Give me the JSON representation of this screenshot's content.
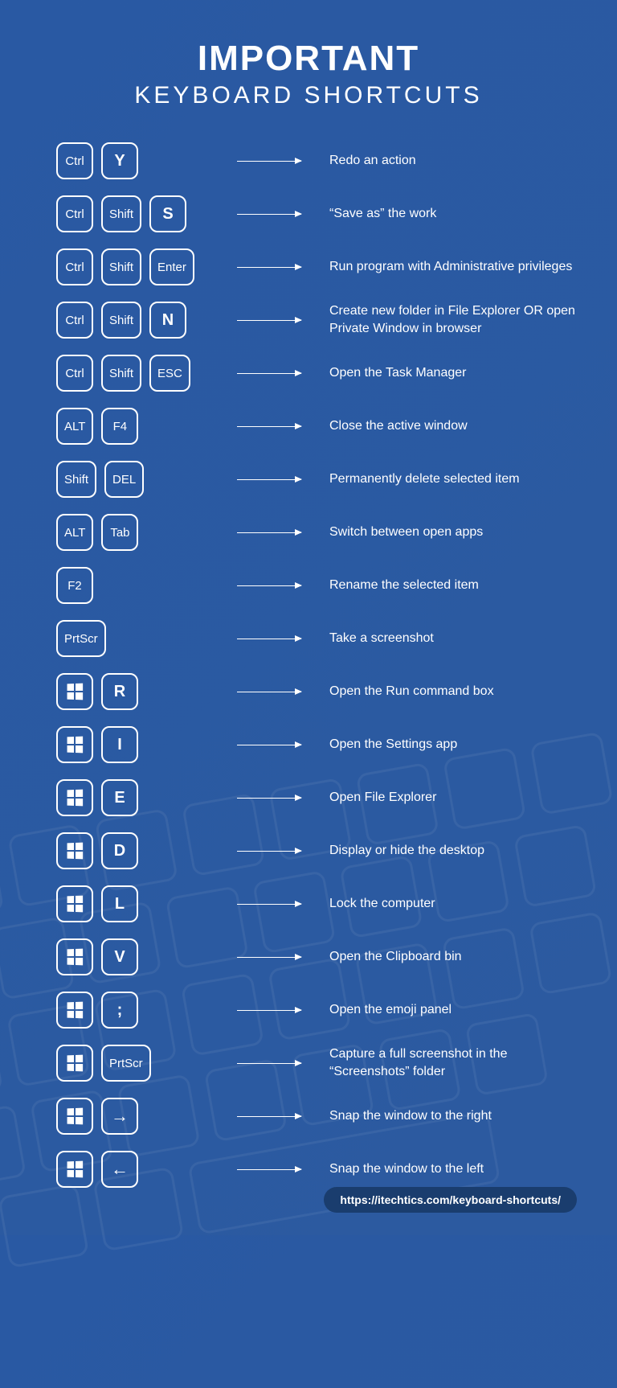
{
  "title1": "IMPORTANT",
  "title2": "KEYBOARD SHORTCUTS",
  "footer": "https://itechtics.com/keyboard-shortcuts/",
  "shortcuts": [
    {
      "keys": [
        {
          "t": "text",
          "v": "Ctrl"
        },
        {
          "t": "text",
          "v": "Y",
          "big": true
        }
      ],
      "desc": "Redo an action"
    },
    {
      "keys": [
        {
          "t": "text",
          "v": "Ctrl"
        },
        {
          "t": "text",
          "v": "Shift"
        },
        {
          "t": "text",
          "v": "S",
          "big": true
        }
      ],
      "desc": "“Save as” the work"
    },
    {
      "keys": [
        {
          "t": "text",
          "v": "Ctrl"
        },
        {
          "t": "text",
          "v": "Shift"
        },
        {
          "t": "text",
          "v": "Enter"
        }
      ],
      "desc": "Run program with Administrative privileges"
    },
    {
      "keys": [
        {
          "t": "text",
          "v": "Ctrl"
        },
        {
          "t": "text",
          "v": "Shift"
        },
        {
          "t": "text",
          "v": "N",
          "big": true
        }
      ],
      "desc": "Create new folder in File Explorer OR open Private Window in browser"
    },
    {
      "keys": [
        {
          "t": "text",
          "v": "Ctrl"
        },
        {
          "t": "text",
          "v": "Shift"
        },
        {
          "t": "text",
          "v": "ESC"
        }
      ],
      "desc": "Open the Task Manager"
    },
    {
      "keys": [
        {
          "t": "text",
          "v": "ALT"
        },
        {
          "t": "text",
          "v": "F4"
        }
      ],
      "desc": "Close the active window"
    },
    {
      "keys": [
        {
          "t": "text",
          "v": "Shift"
        },
        {
          "t": "text",
          "v": "DEL"
        }
      ],
      "desc": "Permanently delete selected item"
    },
    {
      "keys": [
        {
          "t": "text",
          "v": "ALT"
        },
        {
          "t": "text",
          "v": "Tab"
        }
      ],
      "desc": "Switch between open apps"
    },
    {
      "keys": [
        {
          "t": "text",
          "v": "F2"
        }
      ],
      "desc": "Rename the selected item"
    },
    {
      "keys": [
        {
          "t": "text",
          "v": "PrtScr"
        }
      ],
      "desc": "Take a screenshot"
    },
    {
      "keys": [
        {
          "t": "win"
        },
        {
          "t": "text",
          "v": "R",
          "big": true
        }
      ],
      "desc": "Open the Run command box"
    },
    {
      "keys": [
        {
          "t": "win"
        },
        {
          "t": "text",
          "v": "I",
          "big": true
        }
      ],
      "desc": "Open the Settings app"
    },
    {
      "keys": [
        {
          "t": "win"
        },
        {
          "t": "text",
          "v": "E",
          "big": true
        }
      ],
      "desc": "Open File Explorer"
    },
    {
      "keys": [
        {
          "t": "win"
        },
        {
          "t": "text",
          "v": "D",
          "big": true
        }
      ],
      "desc": "Display or hide the desktop"
    },
    {
      "keys": [
        {
          "t": "win"
        },
        {
          "t": "text",
          "v": "L",
          "big": true
        }
      ],
      "desc": "Lock the computer"
    },
    {
      "keys": [
        {
          "t": "win"
        },
        {
          "t": "text",
          "v": "V",
          "big": true
        }
      ],
      "desc": "Open the Clipboard bin"
    },
    {
      "keys": [
        {
          "t": "win"
        },
        {
          "t": "text",
          "v": ";",
          "big": true
        }
      ],
      "desc": "Open the emoji panel"
    },
    {
      "keys": [
        {
          "t": "win"
        },
        {
          "t": "text",
          "v": "PrtScr"
        }
      ],
      "desc": "Capture a full screenshot in the “Screenshots” folder"
    },
    {
      "keys": [
        {
          "t": "win"
        },
        {
          "t": "arrow-right"
        }
      ],
      "desc": "Snap the window to the right"
    },
    {
      "keys": [
        {
          "t": "win"
        },
        {
          "t": "arrow-left"
        }
      ],
      "desc": "Snap the window to the left"
    }
  ]
}
